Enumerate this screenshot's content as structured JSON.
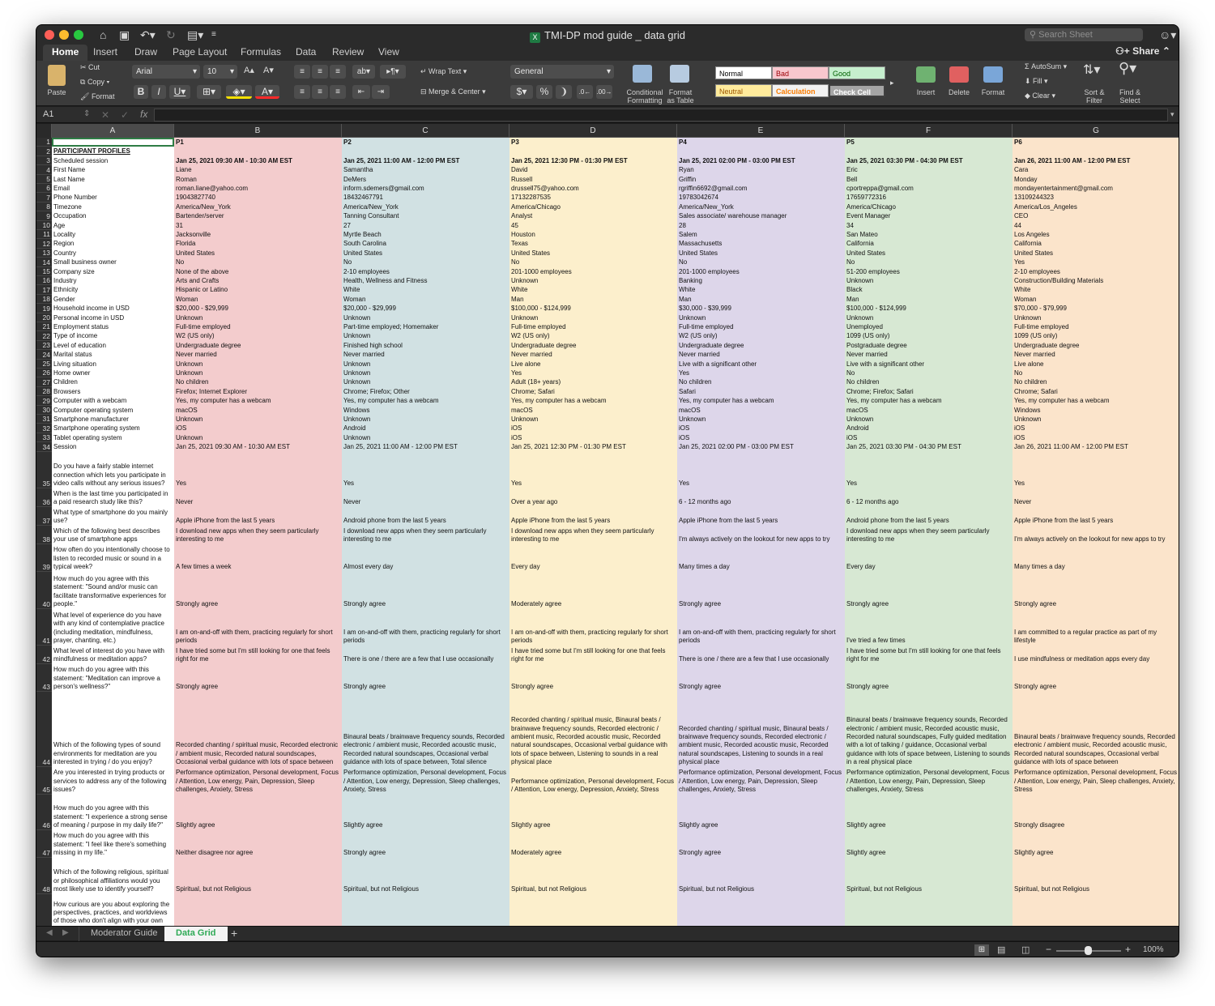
{
  "window": {
    "title": "TMI-DP mod guide _ data grid",
    "search_placeholder": "Search Sheet",
    "share_label": "Share"
  },
  "ribbon_tabs": [
    "Home",
    "Insert",
    "Draw",
    "Page Layout",
    "Formulas",
    "Data",
    "Review",
    "View"
  ],
  "ribbon": {
    "paste": "Paste",
    "cut": "Cut",
    "copy": "Copy",
    "format_painter": "Format",
    "font_name": "Arial",
    "font_size": "10",
    "wrap_text": "Wrap Text",
    "merge_center": "Merge & Center",
    "number_format": "General",
    "conditional_formatting": "Conditional\nFormatting",
    "format_as_table": "Format\nas Table",
    "styles": [
      {
        "label": "Normal",
        "bg": "#ffffff",
        "fg": "#000000"
      },
      {
        "label": "Bad",
        "bg": "#f8c7ce",
        "fg": "#9c0006"
      },
      {
        "label": "Good",
        "bg": "#c6efce",
        "fg": "#006100"
      },
      {
        "label": "Neutral",
        "bg": "#ffeb9c",
        "fg": "#9c5700"
      },
      {
        "label": "Calculation",
        "bg": "#f2f2f2",
        "fg": "#fa7d00"
      },
      {
        "label": "Check Cell",
        "bg": "#a5a5a5",
        "fg": "#ffffff"
      }
    ],
    "insert": "Insert",
    "delete": "Delete",
    "format": "Format",
    "autosum": "AutoSum",
    "fill": "Fill",
    "clear": "Clear",
    "sort_filter": "Sort &\nFilter",
    "find_select": "Find &\nSelect"
  },
  "formula_bar": {
    "name_box": "A1",
    "fx": "fx",
    "content": ""
  },
  "columns": [
    {
      "letter": "A",
      "color": "#ffffff"
    },
    {
      "letter": "B",
      "color": "#f3cccd"
    },
    {
      "letter": "C",
      "color": "#d1e1e3"
    },
    {
      "letter": "D",
      "color": "#fcefcc"
    },
    {
      "letter": "E",
      "color": "#ddd6ea"
    },
    {
      "letter": "F",
      "color": "#d7e8d3"
    },
    {
      "letter": "G",
      "color": "#fbe4cb"
    }
  ],
  "rows": [
    {
      "n": "1",
      "c": [
        "",
        "P1",
        "P2",
        "P3",
        "P4",
        "P5",
        "P6"
      ]
    },
    {
      "n": "2",
      "c": [
        "PARTICIPANT PROFILES",
        "",
        "",
        "",
        "",
        "",
        ""
      ]
    },
    {
      "n": "3",
      "c": [
        "Scheduled session",
        "Jan 25, 2021 09:30 AM - 10:30 AM EST",
        "Jan 25, 2021 11:00 AM - 12:00 PM EST",
        "Jan 25, 2021 12:30 PM - 01:30 PM EST",
        "Jan 25, 2021 02:00 PM - 03:00 PM EST",
        "Jan 25, 2021 03:30 PM - 04:30 PM EST",
        "Jan 26, 2021 11:00 AM - 12:00 PM EST"
      ]
    },
    {
      "n": "4",
      "c": [
        "First Name",
        "Liane",
        "Samantha",
        "David",
        "Ryan",
        "Eric",
        "Cara"
      ]
    },
    {
      "n": "5",
      "c": [
        "Last Name",
        "Roman",
        "DeMers",
        "Russell",
        "Griffin",
        "Bell",
        "Monday"
      ]
    },
    {
      "n": "6",
      "c": [
        "Email",
        "roman.liane@yahoo.com",
        "inform.sdemers@gmail.com",
        "drussell75@yahoo.com",
        "rgriffin6692@gmail.com",
        "cportreppa@gmail.com",
        "mondayentertainment@gmail.com"
      ]
    },
    {
      "n": "7",
      "c": [
        "Phone Number",
        "19043827740",
        "18432467791",
        "17132287535",
        "19783042674",
        "17659772316",
        "13109244323"
      ]
    },
    {
      "n": "8",
      "c": [
        "Timezone",
        "America/New_York",
        "America/New_York",
        "America/Chicago",
        "America/New_York",
        "America/Chicago",
        "America/Los_Angeles"
      ]
    },
    {
      "n": "9",
      "c": [
        "Occupation",
        "Bartender/server",
        "Tanning Consultant",
        "Analyst",
        "Sales associate/ warehouse manager",
        "Event Manager",
        "CEO"
      ]
    },
    {
      "n": "10",
      "c": [
        "Age",
        "31",
        "27",
        "45",
        "28",
        "34",
        "44"
      ]
    },
    {
      "n": "11",
      "c": [
        "Locality",
        "Jacksonville",
        "Myrtle Beach",
        "Houston",
        "Salem",
        "San Mateo",
        "Los Angeles"
      ]
    },
    {
      "n": "12",
      "c": [
        "Region",
        "Florida",
        "South Carolina",
        "Texas",
        "Massachusetts",
        "California",
        "California"
      ]
    },
    {
      "n": "13",
      "c": [
        "Country",
        "United States",
        "United States",
        "United States",
        "United States",
        "United States",
        "United States"
      ]
    },
    {
      "n": "14",
      "c": [
        "Small business owner",
        "No",
        "No",
        "No",
        "No",
        "No",
        "Yes"
      ]
    },
    {
      "n": "15",
      "c": [
        "Company size",
        "None of the above",
        "2-10 employees",
        "201-1000 employees",
        "201-1000 employees",
        "51-200 employees",
        "2-10 employees"
      ]
    },
    {
      "n": "16",
      "c": [
        "Industry",
        "Arts and Crafts",
        "Health, Wellness and Fitness",
        "Unknown",
        "Banking",
        "Unknown",
        "Construction/Building Materials"
      ]
    },
    {
      "n": "17",
      "c": [
        "Ethnicity",
        "Hispanic or Latino",
        "White",
        "White",
        "White",
        "Black",
        "White"
      ]
    },
    {
      "n": "18",
      "c": [
        "Gender",
        "Woman",
        "Woman",
        "Man",
        "Man",
        "Man",
        "Woman"
      ]
    },
    {
      "n": "19",
      "c": [
        "Household income in USD",
        "$20,000 - $29,999",
        "$20,000 - $29,999",
        "$100,000 - $124,999",
        "$30,000 - $39,999",
        "$100,000 - $124,999",
        "$70,000 - $79,999"
      ]
    },
    {
      "n": "20",
      "c": [
        "Personal income in USD",
        "Unknown",
        "Unknown",
        "Unknown",
        "Unknown",
        "Unknown",
        "Unknown"
      ]
    },
    {
      "n": "21",
      "c": [
        "Employment status",
        "Full-time employed",
        "Part-time employed; Homemaker",
        "Full-time employed",
        "Full-time employed",
        "Unemployed",
        "Full-time employed"
      ]
    },
    {
      "n": "22",
      "c": [
        "Type of income",
        "W2 (US only)",
        "Unknown",
        "W2 (US only)",
        "W2 (US only)",
        "1099 (US only)",
        "1099 (US only)"
      ]
    },
    {
      "n": "23",
      "c": [
        "Level of education",
        "Undergraduate degree",
        "Finished high school",
        "Undergraduate degree",
        "Undergraduate degree",
        "Postgraduate degree",
        "Undergraduate degree"
      ]
    },
    {
      "n": "24",
      "c": [
        "Marital status",
        "Never married",
        "Never married",
        "Never married",
        "Never married",
        "Never married",
        "Never married"
      ]
    },
    {
      "n": "25",
      "c": [
        "Living situation",
        "Unknown",
        "Unknown",
        "Live alone",
        "Live with a significant other",
        "Live with a significant other",
        "Live alone"
      ]
    },
    {
      "n": "26",
      "c": [
        "Home owner",
        "Unknown",
        "Unknown",
        "Yes",
        "Yes",
        "No",
        "No"
      ]
    },
    {
      "n": "27",
      "c": [
        "Children",
        "No children",
        "Unknown",
        "Adult (18+ years)",
        "No children",
        "No children",
        "No children"
      ]
    },
    {
      "n": "28",
      "c": [
        "Browsers",
        "Firefox; Internet Explorer",
        "Chrome; Firefox; Other",
        "Chrome; Safari",
        "Safari",
        "Chrome; Firefox; Safari",
        "Chrome; Safari"
      ]
    },
    {
      "n": "29",
      "c": [
        "Computer with a webcam",
        "Yes, my computer has a webcam",
        "Yes, my computer has a webcam",
        "Yes, my computer has a webcam",
        "Yes, my computer has a webcam",
        "Yes, my computer has a webcam",
        "Yes, my computer has a webcam"
      ]
    },
    {
      "n": "30",
      "c": [
        "Computer operating system",
        "macOS",
        "Windows",
        "macOS",
        "macOS",
        "macOS",
        "Windows"
      ]
    },
    {
      "n": "31",
      "c": [
        "Smartphone manufacturer",
        "Unknown",
        "Unknown",
        "Unknown",
        "Unknown",
        "Unknown",
        "Unknown"
      ]
    },
    {
      "n": "32",
      "c": [
        "Smartphone operating system",
        "iOS",
        "Android",
        "iOS",
        "iOS",
        "Android",
        "iOS"
      ]
    },
    {
      "n": "33",
      "c": [
        "Tablet operating system",
        "Unknown",
        "Unknown",
        "iOS",
        "iOS",
        "iOS",
        "iOS"
      ]
    },
    {
      "n": "34",
      "c": [
        "Session",
        "Jan 25, 2021 09:30 AM - 10:30 AM EST",
        "Jan 25, 2021 11:00 AM - 12:00 PM EST",
        "Jan 25, 2021 12:30 PM - 01:30 PM EST",
        "Jan 25, 2021 02:00 PM - 03:00 PM EST",
        "Jan 25, 2021 03:30 PM - 04:30 PM EST",
        "Jan 26, 2021 11:00 AM - 12:00 PM EST"
      ]
    },
    {
      "n": "35",
      "c": [
        "Do you have a fairly stable internet connection which lets you participate in video calls without any serious issues?",
        "Yes",
        "Yes",
        "Yes",
        "Yes",
        "Yes",
        "Yes"
      ]
    },
    {
      "n": "36",
      "c": [
        "When is the last time you participated in a paid research study like this?",
        "Never",
        "Never",
        "Over a year ago",
        "6 - 12 months ago",
        "6 - 12 months ago",
        "Never"
      ]
    },
    {
      "n": "37",
      "c": [
        "What type of smartphone do you mainly use?",
        "Apple iPhone from the last 5 years",
        "Android phone from the last 5 years",
        "Apple iPhone from the last 5 years",
        "Apple iPhone from the last 5 years",
        "Android phone from the last 5 years",
        "Apple iPhone from the last 5 years"
      ]
    },
    {
      "n": "38",
      "c": [
        "Which of the following best describes your use of smartphone apps",
        "I download new apps when they seem particularly interesting to me",
        "I download new apps when they seem particularly interesting to me",
        "I download new apps when they seem particularly interesting to me",
        "I'm always actively on the lookout for new apps to try",
        "I download new apps when they seem particularly interesting to me",
        "I'm always actively on the lookout for new apps to try"
      ]
    },
    {
      "n": "39",
      "c": [
        "How often do you intentionally choose to listen to recorded music or sound in a typical week?",
        "A few times a week",
        "Almost every day",
        "Every day",
        "Many times a day",
        "Every day",
        "Many times a day"
      ]
    },
    {
      "n": "40",
      "c": [
        "How much do you agree with this statement: \"Sound and/or music can facilitate transformative experiences for people.\"",
        "Strongly agree",
        "Strongly agree",
        "Moderately agree",
        "Strongly agree",
        "Strongly agree",
        "Strongly agree"
      ]
    },
    {
      "n": "41",
      "c": [
        "What level of experience do you have with any kind of contemplative practice (including meditation, mindfulness, prayer, chanting, etc.)",
        "I am on-and-off with them, practicing regularly for short periods",
        "I am on-and-off with them, practicing regularly for short periods",
        "I am on-and-off with them, practicing regularly for short periods",
        "I am on-and-off with them, practicing regularly for short periods",
        "I've tried a few times",
        "I am committed to a regular practice as part of my lifestyle"
      ]
    },
    {
      "n": "42",
      "c": [
        "What level of interest do you have with mindfulness or meditation apps?",
        "I have tried some but I'm still looking for one that feels right for me",
        "There is one / there are a few that I use occasionally",
        "I have tried some but I'm still looking for one that feels right for me",
        "There is one / there are a few that I use occasionally",
        "I have tried some but I'm still looking for one that feels right for me",
        "I use mindfulness or meditation apps every day"
      ]
    },
    {
      "n": "43",
      "c": [
        "How much do you agree with this statement: \"Meditation can improve a person's wellness?\"",
        "Strongly agree",
        "Strongly agree",
        "Strongly agree",
        "Strongly agree",
        "Strongly agree",
        "Strongly agree"
      ]
    },
    {
      "n": "44",
      "c": [
        "Which of the following types of sound environments for meditation are you interested in trying / do you enjoy?",
        "Recorded chanting / spiritual music, Recorded electronic / ambient music, Recorded natural soundscapes, Occasional verbal guidance with lots of space between",
        "Binaural beats / brainwave frequency sounds, Recorded electronic / ambient music, Recorded acoustic music, Recorded natural soundscapes, Occasional verbal guidance with lots of space between, Total silence",
        "Recorded chanting / spiritual music, Binaural beats / brainwave frequency sounds, Recorded electronic / ambient music, Recorded acoustic music, Recorded natural soundscapes, Occasional verbal guidance with lots of space between, Listening to sounds in a real physical place",
        "Recorded chanting / spiritual music, Binaural beats / brainwave frequency sounds, Recorded electronic / ambient music, Recorded acoustic music, Recorded natural soundscapes, Listening to sounds in a real physical place",
        "Binaural beats / brainwave frequency sounds, Recorded electronic / ambient music, Recorded acoustic music, Recorded natural soundscapes, Fully guided meditation with a lot of talking / guidance, Occasional verbal guidance with lots of space between, Listening to sounds in a real physical place",
        "Binaural beats / brainwave frequency sounds, Recorded electronic / ambient music, Recorded acoustic music, Recorded natural soundscapes, Occasional verbal guidance with lots of space between"
      ]
    },
    {
      "n": "45",
      "c": [
        "Are you interested in trying products or services to address any of the following issues?",
        "Performance optimization, Personal development, Focus / Attention, Low energy, Pain, Depression, Sleep challenges, Anxiety, Stress",
        "Performance optimization, Personal development, Focus / Attention, Low energy, Depression, Sleep challenges, Anxiety, Stress",
        "Performance optimization, Personal development, Focus / Attention, Low energy, Depression, Anxiety, Stress",
        "Performance optimization, Personal development, Focus / Attention, Low energy, Pain, Depression, Sleep challenges, Anxiety, Stress",
        "Performance optimization, Personal development, Focus / Attention, Low energy, Pain, Depression, Sleep challenges, Anxiety, Stress",
        "Performance optimization, Personal development, Focus / Attention, Low energy, Pain, Sleep challenges, Anxiety, Stress"
      ]
    },
    {
      "n": "46",
      "c": [
        "How much do you agree with this statement: \"I experience a strong sense of meaning / purpose in my daily life?\"",
        "Slightly agree",
        "Slightly agree",
        "Slightly agree",
        "Slightly agree",
        "Slightly agree",
        "Strongly disagree"
      ]
    },
    {
      "n": "47",
      "c": [
        "How much do you agree with this statement: \"I feel like there's something missing in my life.\"",
        "Neither disagree nor agree",
        "Strongly agree",
        "Moderately agree",
        "Strongly agree",
        "Slightly agree",
        "Slightly agree"
      ]
    },
    {
      "n": "48",
      "c": [
        "Which of the following religious, spiritual or philosophical affiliations would you most likely use to identify yourself?",
        "Spiritual, but not Religious",
        "Spiritual, but not Religious",
        "Spiritual, but not Religious",
        "Spiritual, but not Religious",
        "Spiritual, but not Religious",
        "Spiritual, but not Religious"
      ]
    },
    {
      "n": "49",
      "c": [
        "How curious are you about exploring the perspectives, practices, and worldviews of those who don't align with your own religious, spiritual or philosophical affiliation?",
        "",
        "",
        "",
        "",
        "",
        ""
      ]
    }
  ],
  "sheet_tabs": [
    "Moderator Guide",
    "Data Grid"
  ],
  "active_sheet": "Data Grid",
  "status": {
    "zoom": "100%"
  }
}
